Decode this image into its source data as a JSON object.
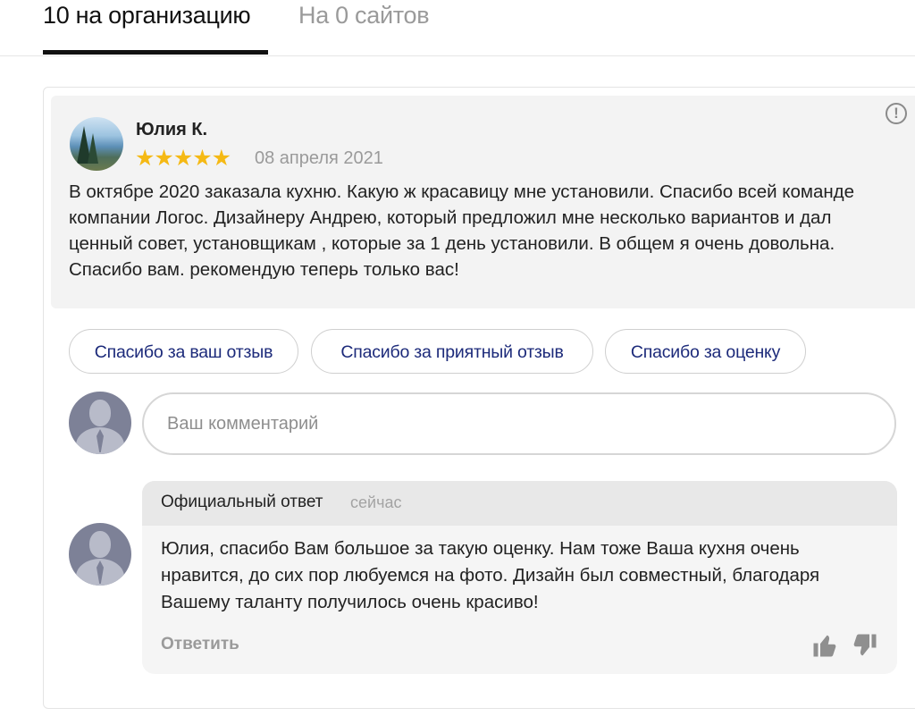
{
  "tabs": [
    {
      "label": "10 на организацию",
      "active": true
    },
    {
      "label": "На 0 сайтов",
      "active": false
    }
  ],
  "review": {
    "author": "Юлия К.",
    "rating": 5,
    "stars": "★★★★★",
    "date": "08 апреля 2021",
    "text": "В октябре 2020 заказала кухню. Какую ж красавицу мне установили. Спасибо всей команде компании Логос. Дизайнеру Андрею, который предложил мне несколько вариантов и дал ценный совет, установщикам , которые за 1 день установили. В общем я очень довольна. Спасибо вам. рекомендую теперь только вас!",
    "report_icon": "exclamation-circle-icon"
  },
  "quick_replies": [
    "Спасибо за ваш отзыв",
    "Спасибо за приятный отзыв",
    "Спасибо за оценку"
  ],
  "comment": {
    "placeholder": "Ваш комментарий",
    "value": ""
  },
  "official_reply": {
    "label": "Официальный ответ",
    "time": "сейчас",
    "text": "Юлия, спасибо Вам большое за такую оценку. Нам тоже Ваша кухня очень нравится, до сих пор любуемся на фото. Дизайн был совместный, благодаря Вашему  таланту получилось очень красиво!",
    "reply_action": "Ответить"
  },
  "colors": {
    "star": "#f5b914",
    "chip_text": "#1c2a7a",
    "muted": "#9a9a9a"
  }
}
